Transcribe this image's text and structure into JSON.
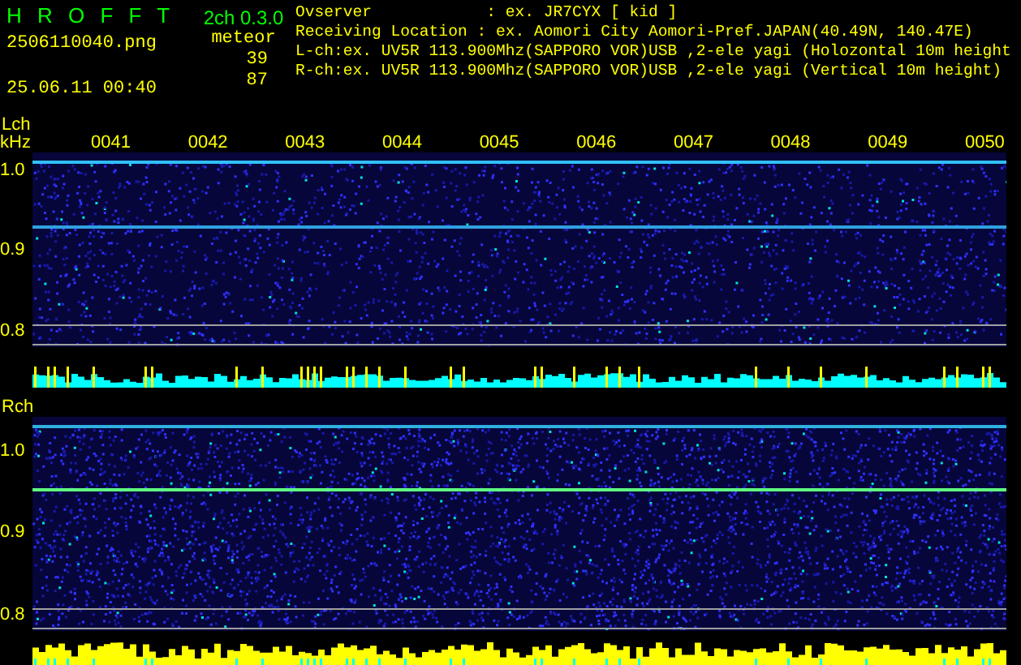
{
  "header": {
    "app_title": "H R O F F T",
    "version": "2ch 0.3.0",
    "filename": "2506110040.png",
    "datetime": "25.06.11 00:40",
    "meteor_label": "meteor",
    "counts": [
      "39",
      "87"
    ],
    "info_lines": [
      "Ovserver            : ex. JR7CYX [ kid ]",
      "Receiving Location : ex. Aomori City Aomori-Pref.JAPAN(40.49N, 140.47E)",
      "L-ch:ex. UV5R 113.900Mhz(SAPPORO VOR)USB ,2-ele yagi (Holozontal 10m height",
      "R-ch:ex. UV5R 113.900Mhz(SAPPORO VOR)USB ,2-ele yagi (Vertical 10m height)"
    ]
  },
  "channels": [
    {
      "label": "Lch",
      "unit": "kHz",
      "times": [
        "0041",
        "0042",
        "0043",
        "0044",
        "0045",
        "0046",
        "0047",
        "0048",
        "0049",
        "0050"
      ],
      "yticks": [
        "1.0",
        "0.9",
        "0.8"
      ]
    },
    {
      "label": "Rch",
      "yticks": [
        "1.0",
        "0.9",
        "0.8"
      ]
    }
  ]
}
